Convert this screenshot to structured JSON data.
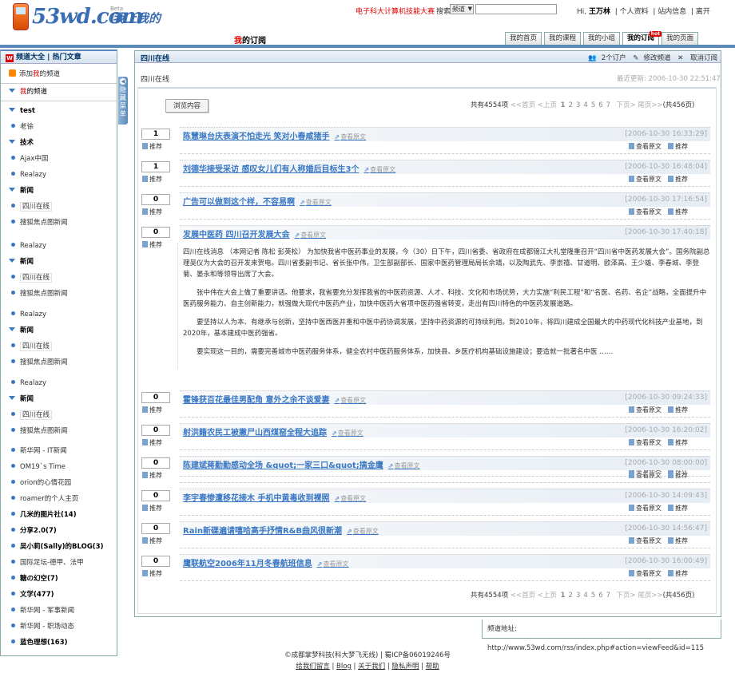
{
  "header": {
    "logo_text": "53wd.com",
    "logo_beta": "Beta",
    "logo_slogan": "我上我的",
    "contest_link": "电子科大计算机技能大赛",
    "search_label": "搜索",
    "search_select": "频道",
    "search_value": "",
    "user_greeting": "Hi, ",
    "user_name": "王万林",
    "user_links": [
      "个人资料",
      "站内信息",
      "离开"
    ]
  },
  "page_title_prefix": "我",
  "page_title_rest": "的订阅",
  "tabs": [
    {
      "label": "我的首页",
      "active": false
    },
    {
      "label": "我的课程",
      "active": false
    },
    {
      "label": "我的小组",
      "active": false
    },
    {
      "label": "我的订阅",
      "active": true,
      "badge": "hot"
    },
    {
      "label": "我的页面",
      "active": false
    }
  ],
  "sidebar": {
    "head_links": [
      "频道大全",
      "热门文章"
    ],
    "add_label_pre": "添加",
    "add_label_red": "我",
    "add_label_post": "的频道",
    "my_channels_pre": "我",
    "my_channels_post": "的频道",
    "items": [
      {
        "type": "cat",
        "label": "test"
      },
      {
        "type": "feed",
        "label": "老徐"
      },
      {
        "type": "cat",
        "label": "技术"
      },
      {
        "type": "feed",
        "label": "Ajax中国"
      },
      {
        "type": "feed",
        "label": "Realazy"
      },
      {
        "type": "cat",
        "label": "新闻"
      },
      {
        "type": "feed",
        "label": "四川在线",
        "sel": true
      },
      {
        "type": "feed",
        "label": "搜狐焦点图新闻"
      },
      {
        "type": "feed",
        "label": "Realazy"
      },
      {
        "type": "cat",
        "label": "新闻"
      },
      {
        "type": "feed",
        "label": "四川在线",
        "sel": true
      },
      {
        "type": "feed",
        "label": "搜狐焦点图新闻"
      },
      {
        "type": "feed",
        "label": "Realazy"
      },
      {
        "type": "cat",
        "label": "新闻"
      },
      {
        "type": "feed",
        "label": "四川在线",
        "sel": true
      },
      {
        "type": "feed",
        "label": "搜狐焦点图新闻"
      },
      {
        "type": "feed",
        "label": "Realazy"
      },
      {
        "type": "cat",
        "label": "新闻"
      },
      {
        "type": "feed",
        "label": "四川在线",
        "sel": true
      },
      {
        "type": "feed",
        "label": "搜狐焦点图新闻"
      },
      {
        "type": "feed",
        "label": "新华网 - IT新闻"
      },
      {
        "type": "feed",
        "label": "OM19`s Time"
      },
      {
        "type": "feed",
        "label": "orion的心情花园"
      },
      {
        "type": "feed",
        "label": "roamer的个人主页"
      },
      {
        "type": "feed",
        "label": "几米的图片社(14)",
        "bold": true
      },
      {
        "type": "feed",
        "label": "分享2.0(7)",
        "bold": true
      },
      {
        "type": "feed",
        "label": "吴小莉(Sally)的BLOG(3)",
        "bold": true
      },
      {
        "type": "feed",
        "label": "国际足坛-德甲、法甲"
      },
      {
        "type": "feed",
        "label": "糖の幻空(7)",
        "bold": true
      },
      {
        "type": "feed",
        "label": "文学(477)",
        "bold": true
      },
      {
        "type": "feed",
        "label": "新华网 - 军事新闻"
      },
      {
        "type": "feed",
        "label": "新华网 - 职场动态"
      },
      {
        "type": "feed",
        "label": "蓝色理想(163)",
        "bold": true
      }
    ]
  },
  "hide_menu": "隐藏菜单",
  "main": {
    "head_title": "四川在线",
    "head_actions": [
      "2个订户",
      "修改频道",
      "取消订阅"
    ],
    "channel_name": "四川在线",
    "last_update_label": "最近更新: 2006-10-30 22:51:47",
    "browse_button": "浏览内容",
    "pager": {
      "total": "共有4554项",
      "first": "<<首页",
      "prev": "<上页",
      "pages": [
        "1",
        "2",
        "3",
        "4",
        "5",
        "6",
        "7"
      ],
      "current": "1",
      "next": "下页>",
      "last": "尾页>>",
      "total_pages": "(共456页)"
    },
    "view_original": "查看原文",
    "recommend": "推荐",
    "items": [
      {
        "count": "1",
        "title": "陈慧琳台庆表演不怕走光 笑对小春咸猪手",
        "date": "[2006-10-30 16:33:29]"
      },
      {
        "count": "1",
        "title": "刘德华接受采访 感叹女儿们有人称婚后目标生3个",
        "date": "[2006-10-30 16:48:04]"
      },
      {
        "count": "0",
        "title": "广告可以做到这个样，不容易啊",
        "date": "[2006-10-30 17:16:54]"
      },
      {
        "count": "0",
        "title": "发展中医药 四川召开发展大会",
        "date": "[2006-10-30 17:40:18]"
      },
      {
        "count": "0",
        "title": "霍锋获百花最佳男配角 意外之余不谈爱妻",
        "date": "[2006-10-30 09:24:33]"
      },
      {
        "count": "0",
        "title": "射洪籍农民工被撇尸山西煤窑全程大追踪",
        "date": "[2006-10-30 16:20:02]"
      },
      {
        "count": "0",
        "title": "陈建斌蒋勤勤感动全场 &quot;一家三口&quot;搞金鹰",
        "date": "[2006-10-30 08:00:00]"
      },
      {
        "count": "0",
        "title": "李宇春惨遭移花接木 手机中黄毒收到裸照",
        "date": "[2006-10-30 14:09:43]"
      },
      {
        "count": "0",
        "title": "Rain新碟遍请嘻哈高手抒情R&B曲风很新潮",
        "date": "[2006-10-30 14:56:47]"
      },
      {
        "count": "0",
        "title": "鹰联航空2006年11月冬春航班信息",
        "date": "[2006-10-30 16:00:49]"
      }
    ],
    "article_paragraphs": [
      "四川在线消息    （本网记者 陈松 彭英松）    为加快我省中医药事业的发展，今（30）日下午，四川省委、省政府在成都锦江大礼堂隆重召开“四川省中医药发展大会”。国务院副总理吴仪为大会的召开发来贺电。四川省委副书记、省长张中伟，卫生部副部长、国家中医药管理局局长佘靖，以及陶武先、李崇禧、甘道明、欧泽高、王少雄、李春城、李登菊、晏永和等领导出席了大会。",
      "张中伟在大会上做了重要讲话。他要求，我省要充分发挥我省的中医药资源、人才、科技、文化和市场优势，大力实施“利民工程”和“名医、名药、名企”战略，全面提升中医药服务能力、自主创新能力，就强做大现代中医药产业，加快中医药大省项中医药强省转变，走出有四川特色的中医药发展道路。",
      "要坚持以人为本、有继承与创新，坚持中医西医并重和中医中药协调发展，坚持中药资源的可持续利用。到2010年，将四川建成全国最大的中药现代化科技产业基地，到2020年，基本建成中医药强省。",
      "要实现这一目的，需要完善城市中医药服务体系，健全农村中医药服务体系，加快县、乡医疗机构基础设施建设；要造就一批著名中医  ……"
    ],
    "feed_url_label": "频道地址: http://www.53wd.com/rss/index.php#action=viewFeed&id=115"
  },
  "footer": {
    "copyright": "©成都掌梦科技(科大梦飞无线) | 蜀ICP备06019246号",
    "links": [
      "给我们留言",
      "Blog",
      "关于我们",
      "隐私声明",
      "帮助"
    ]
  }
}
